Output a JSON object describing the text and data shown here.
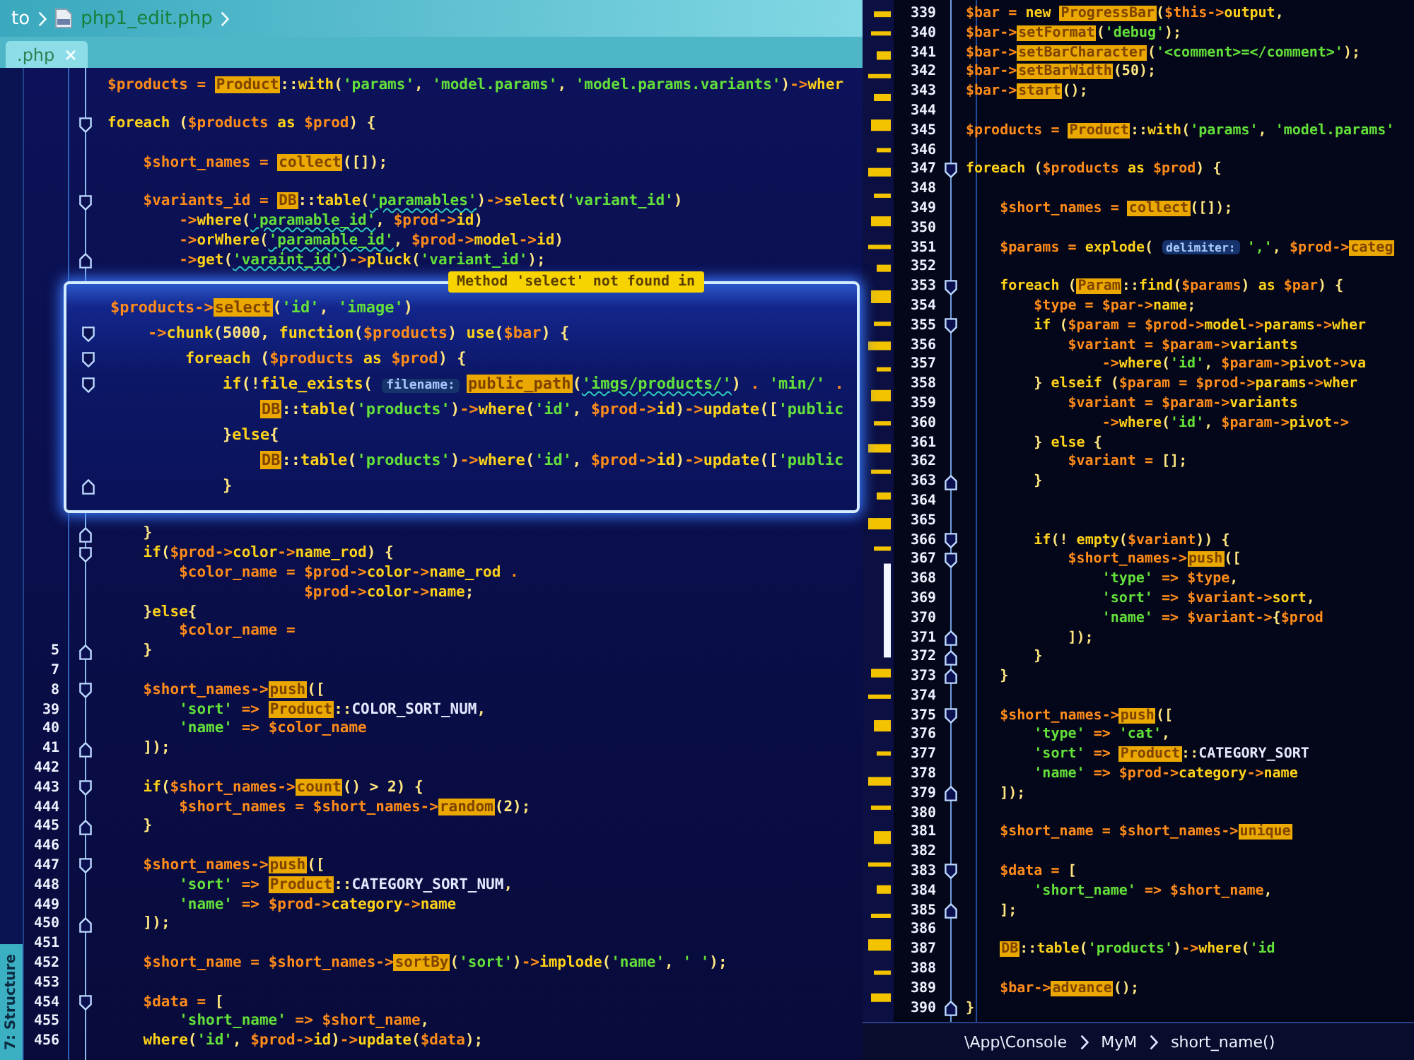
{
  "breadcrumb": [
    {
      "kind": "folder",
      "label": "to"
    },
    {
      "kind": "file",
      "label": "php1_edit.php"
    }
  ],
  "tabs": [
    {
      "label": ".php",
      "selected": true
    }
  ],
  "tool_window_tab": {
    "label": "7: Structure"
  },
  "side_line_numbers": [
    "5",
    "7",
    "8",
    "39",
    "40",
    "41",
    "442",
    "443",
    "444",
    "445",
    "446",
    "447",
    "448",
    "449",
    "450",
    "451",
    "452",
    "453",
    "454",
    "455",
    "456"
  ],
  "editor_left": {
    "lines": [
      {
        "kind": "line",
        "segments": [
          {
            "kind": "code",
            "text": "$products = "
          },
          {
            "kind": "warn",
            "text": "Product"
          },
          {
            "kind": "code",
            "text": "::with('params', 'model.params', 'model.params.variants')->wher"
          }
        ]
      },
      {
        "kind": "blank"
      },
      {
        "kind": "open",
        "text": "foreach ($products as $prod) {"
      },
      {
        "kind": "blank"
      },
      {
        "kind": "line",
        "segments": [
          {
            "kind": "code",
            "text": "    $short_names = "
          },
          {
            "kind": "warn",
            "text": "collect"
          },
          {
            "kind": "code",
            "text": "([]);"
          }
        ]
      },
      {
        "kind": "blank"
      },
      {
        "kind": "open",
        "segments": [
          {
            "kind": "code",
            "text": "    $variants_id = "
          },
          {
            "kind": "warn",
            "text": "DB"
          },
          {
            "kind": "code",
            "text": "::table("
          },
          {
            "kind": "typo",
            "text": "'paramables'"
          },
          {
            "kind": "code",
            "text": ")->select('variant_id')"
          }
        ]
      },
      {
        "kind": "line",
        "segments": [
          {
            "kind": "code",
            "text": "        ->where("
          },
          {
            "kind": "typo",
            "text": "'paramable_id'"
          },
          {
            "kind": "code",
            "text": ", $prod->id)"
          }
        ]
      },
      {
        "kind": "line",
        "segments": [
          {
            "kind": "code",
            "text": "        ->orWhere("
          },
          {
            "kind": "typo",
            "text": "'paramable_id'"
          },
          {
            "kind": "code",
            "text": ", $prod->model->id)"
          }
        ]
      },
      {
        "kind": "close",
        "segments": [
          {
            "kind": "code",
            "text": "        ->get("
          },
          {
            "kind": "typo",
            "text": "'varaint_id'"
          },
          {
            "kind": "code",
            "text": ")->pluck('variant_id');"
          }
        ]
      },
      {
        "kind": "popup",
        "tooltip": "Method 'select' not found in",
        "lines": [
          {
            "kind": "line",
            "segments": [
              {
                "kind": "code",
                "text": "$products->"
              },
              {
                "kind": "warn",
                "text": "select"
              },
              {
                "kind": "code",
                "text": "('id', 'image')"
              }
            ]
          },
          {
            "kind": "open",
            "text": "    ->chunk(5000, function($products) use($bar) {"
          },
          {
            "kind": "open",
            "text": "        foreach ($products as $prod) {"
          },
          {
            "kind": "open",
            "segments": [
              {
                "kind": "code",
                "text": "            if(!file_exists( "
              },
              {
                "kind": "hint",
                "text": "filename:"
              },
              {
                "kind": "warn",
                "text": "public_path"
              },
              {
                "kind": "code",
                "text": "("
              },
              {
                "kind": "typo",
                "text": "'imgs/products/'"
              },
              {
                "kind": "code",
                "text": ") . 'min/' ."
              }
            ]
          },
          {
            "kind": "line",
            "segments": [
              {
                "kind": "warn",
                "text": "                DB"
              },
              {
                "kind": "code",
                "text": "::table('products')->where('id', $prod->id)->update(['public"
              }
            ]
          },
          {
            "kind": "line",
            "text": "            }else{"
          },
          {
            "kind": "line",
            "segments": [
              {
                "kind": "warn",
                "text": "                DB"
              },
              {
                "kind": "code",
                "text": "::table('products')->where('id', $prod->id)->update(['public"
              }
            ]
          },
          {
            "kind": "close",
            "text": "            }"
          }
        ]
      },
      {
        "kind": "close",
        "text": "    }"
      },
      {
        "kind": "open",
        "text": "    if($prod->color->name_rod) {"
      },
      {
        "kind": "line",
        "text": "        $color_name = $prod->color->name_rod ."
      },
      {
        "kind": "line",
        "text": "                      $prod->color->name;"
      },
      {
        "kind": "line",
        "text": "    }else{"
      },
      {
        "kind": "line",
        "text": "        $color_name ="
      },
      {
        "kind": "close",
        "text": "    }"
      },
      {
        "kind": "blank"
      },
      {
        "kind": "open",
        "segments": [
          {
            "kind": "code",
            "text": "    $short_names->"
          },
          {
            "kind": "warn",
            "text": "push"
          },
          {
            "kind": "code",
            "text": "(["
          }
        ]
      },
      {
        "kind": "line",
        "segments": [
          {
            "kind": "code",
            "text": "        'sort' => "
          },
          {
            "kind": "warn",
            "text": "Product"
          },
          {
            "kind": "code",
            "text": "::COLOR_SORT_NUM,"
          }
        ]
      },
      {
        "kind": "line",
        "text": "        'name' => $color_name"
      },
      {
        "kind": "close",
        "text": "    ]);"
      },
      {
        "kind": "blank"
      },
      {
        "kind": "open",
        "segments": [
          {
            "kind": "code",
            "text": "    if($short_names->"
          },
          {
            "kind": "warn",
            "text": "count"
          },
          {
            "kind": "code",
            "text": "() > 2) {"
          }
        ]
      },
      {
        "kind": "line",
        "segments": [
          {
            "kind": "code",
            "text": "        $short_names = $short_names->"
          },
          {
            "kind": "warn",
            "text": "random"
          },
          {
            "kind": "code",
            "text": "(2);"
          }
        ]
      },
      {
        "kind": "close",
        "text": "    }"
      },
      {
        "kind": "blank"
      },
      {
        "kind": "open",
        "segments": [
          {
            "kind": "code",
            "text": "    $short_names->"
          },
          {
            "kind": "warn",
            "text": "push"
          },
          {
            "kind": "code",
            "text": "(["
          }
        ]
      },
      {
        "kind": "line",
        "segments": [
          {
            "kind": "code",
            "text": "        'sort' => "
          },
          {
            "kind": "warn",
            "text": "Product"
          },
          {
            "kind": "code",
            "text": "::CATEGORY_SORT_NUM,"
          }
        ]
      },
      {
        "kind": "line",
        "text": "        'name' => $prod->category->name"
      },
      {
        "kind": "close",
        "text": "    ]);"
      },
      {
        "kind": "blank"
      },
      {
        "kind": "line",
        "segments": [
          {
            "kind": "code",
            "text": "    $short_name = $short_names->"
          },
          {
            "kind": "warn",
            "text": "sortBy"
          },
          {
            "kind": "code",
            "text": "('sort')->implode('name', ' ');"
          }
        ]
      },
      {
        "kind": "blank"
      },
      {
        "kind": "open",
        "text": "    $data = ["
      },
      {
        "kind": "line",
        "text": "        'short_name' => $short_name,"
      },
      {
        "kind": "line",
        "text": "    where('id', $prod->id)->update($data);"
      }
    ]
  },
  "editor_right": {
    "lines": [
      {
        "number": "339",
        "kind": "line",
        "segments": [
          {
            "kind": "code",
            "text": "$bar = new "
          },
          {
            "kind": "warn",
            "text": "ProgressBar"
          },
          {
            "kind": "code",
            "text": "($this->output,"
          }
        ]
      },
      {
        "number": "340",
        "kind": "line",
        "segments": [
          {
            "kind": "code",
            "text": "$bar->"
          },
          {
            "kind": "warn",
            "text": "setFormat"
          },
          {
            "kind": "code",
            "text": "('debug');"
          }
        ]
      },
      {
        "number": "341",
        "kind": "line",
        "segments": [
          {
            "kind": "code",
            "text": "$bar->"
          },
          {
            "kind": "warn",
            "text": "setBarCharacter"
          },
          {
            "kind": "code",
            "text": "('<comment>=</comment>');"
          }
        ]
      },
      {
        "number": "342",
        "kind": "line",
        "segments": [
          {
            "kind": "code",
            "text": "$bar->"
          },
          {
            "kind": "warn",
            "text": "setBarWidth"
          },
          {
            "kind": "code",
            "text": "(50);"
          }
        ]
      },
      {
        "number": "343",
        "kind": "line",
        "segments": [
          {
            "kind": "code",
            "text": "$bar->"
          },
          {
            "kind": "warn",
            "text": "start"
          },
          {
            "kind": "code",
            "text": "();"
          }
        ]
      },
      {
        "number": "344",
        "kind": "blank"
      },
      {
        "number": "345",
        "kind": "line",
        "segments": [
          {
            "kind": "code",
            "text": "$products = "
          },
          {
            "kind": "warn",
            "text": "Product"
          },
          {
            "kind": "code",
            "text": "::with('params', 'model.params'"
          }
        ]
      },
      {
        "number": "346",
        "kind": "blank"
      },
      {
        "number": "347",
        "kind": "open",
        "text": "foreach ($products as $prod) {"
      },
      {
        "number": "348",
        "kind": "blank"
      },
      {
        "number": "349",
        "kind": "line",
        "segments": [
          {
            "kind": "code",
            "text": "    $short_names = "
          },
          {
            "kind": "warn",
            "text": "collect"
          },
          {
            "kind": "code",
            "text": "([]);"
          }
        ]
      },
      {
        "number": "350",
        "kind": "blank"
      },
      {
        "number": "351",
        "kind": "line",
        "segments": [
          {
            "kind": "code",
            "text": "    $params = explode( "
          },
          {
            "kind": "hint",
            "text": "delimiter:"
          },
          {
            "kind": "code",
            "text": "',', $prod->"
          },
          {
            "kind": "warn",
            "text": "categ"
          }
        ]
      },
      {
        "number": "352",
        "kind": "blank"
      },
      {
        "number": "353",
        "kind": "open",
        "segments": [
          {
            "kind": "code",
            "text": "    foreach ("
          },
          {
            "kind": "warn",
            "text": "Param"
          },
          {
            "kind": "code",
            "text": "::find($params) as $par) {"
          }
        ]
      },
      {
        "number": "354",
        "kind": "line",
        "text": "        $type = $par->name;"
      },
      {
        "number": "355",
        "kind": "open",
        "text": "        if ($param = $prod->model->params->wher"
      },
      {
        "number": "356",
        "kind": "line",
        "text": "            $variant = $param->variants"
      },
      {
        "number": "357",
        "kind": "line",
        "text": "                ->where('id', $param->pivot->va"
      },
      {
        "number": "358",
        "kind": "line",
        "text": "        } elseif ($param = $prod->params->wher"
      },
      {
        "number": "359",
        "kind": "line",
        "text": "            $variant = $param->variants"
      },
      {
        "number": "360",
        "kind": "line",
        "text": "                ->where('id', $param->pivot->"
      },
      {
        "number": "361",
        "kind": "line",
        "text": "        } else {"
      },
      {
        "number": "362",
        "kind": "line",
        "text": "            $variant = [];"
      },
      {
        "number": "363",
        "kind": "close",
        "text": "        }"
      },
      {
        "number": "364",
        "kind": "blank"
      },
      {
        "number": "365",
        "kind": "blank"
      },
      {
        "number": "366",
        "kind": "open",
        "text": "        if(! empty($variant)) {"
      },
      {
        "number": "367",
        "kind": "open",
        "segments": [
          {
            "kind": "code",
            "text": "            $short_names->"
          },
          {
            "kind": "warn",
            "text": "push"
          },
          {
            "kind": "code",
            "text": "(["
          }
        ]
      },
      {
        "number": "368",
        "kind": "line",
        "text": "                'type' => $type,"
      },
      {
        "number": "369",
        "kind": "line",
        "text": "                'sort' => $variant->sort,"
      },
      {
        "number": "370",
        "kind": "line",
        "text": "                'name' => $variant->{$prod"
      },
      {
        "number": "371",
        "kind": "close",
        "text": "            ]);"
      },
      {
        "number": "372",
        "kind": "close",
        "text": "        }"
      },
      {
        "number": "373",
        "kind": "close",
        "text": "    }"
      },
      {
        "number": "374",
        "kind": "blank"
      },
      {
        "number": "375",
        "kind": "open",
        "segments": [
          {
            "kind": "code",
            "text": "    $short_names->"
          },
          {
            "kind": "warn",
            "text": "push"
          },
          {
            "kind": "code",
            "text": "(["
          }
        ]
      },
      {
        "number": "376",
        "kind": "line",
        "text": "        'type' => 'cat',"
      },
      {
        "number": "377",
        "kind": "line",
        "segments": [
          {
            "kind": "code",
            "text": "        'sort' => "
          },
          {
            "kind": "warn",
            "text": "Product"
          },
          {
            "kind": "code",
            "text": "::CATEGORY_SORT"
          }
        ]
      },
      {
        "number": "378",
        "kind": "line",
        "text": "        'name' => $prod->category->name"
      },
      {
        "number": "379",
        "kind": "close",
        "text": "    ]);"
      },
      {
        "number": "380",
        "kind": "blank"
      },
      {
        "number": "381",
        "kind": "line",
        "segments": [
          {
            "kind": "code",
            "text": "    $short_name = $short_names->"
          },
          {
            "kind": "warn",
            "text": "unique"
          }
        ]
      },
      {
        "number": "382",
        "kind": "blank"
      },
      {
        "number": "383",
        "kind": "open",
        "text": "    $data = ["
      },
      {
        "number": "384",
        "kind": "line",
        "text": "        'short_name' => $short_name,"
      },
      {
        "number": "385",
        "kind": "close",
        "text": "    ];"
      },
      {
        "number": "386",
        "kind": "blank"
      },
      {
        "number": "387",
        "kind": "line",
        "segments": [
          {
            "kind": "warn",
            "text": "    DB"
          },
          {
            "kind": "code",
            "text": "::table('products')->where('id"
          }
        ]
      },
      {
        "number": "388",
        "kind": "blank"
      },
      {
        "number": "389",
        "kind": "line",
        "segments": [
          {
            "kind": "code",
            "text": "    $bar->"
          },
          {
            "kind": "warn",
            "text": "advance"
          },
          {
            "kind": "code",
            "text": "();"
          }
        ]
      },
      {
        "number": "390",
        "kind": "close",
        "text": "}"
      }
    ]
  },
  "navigation_bar": [
    {
      "label": "\\App\\Console"
    },
    {
      "label": "MyM"
    },
    {
      "label": "short_name()"
    }
  ]
}
